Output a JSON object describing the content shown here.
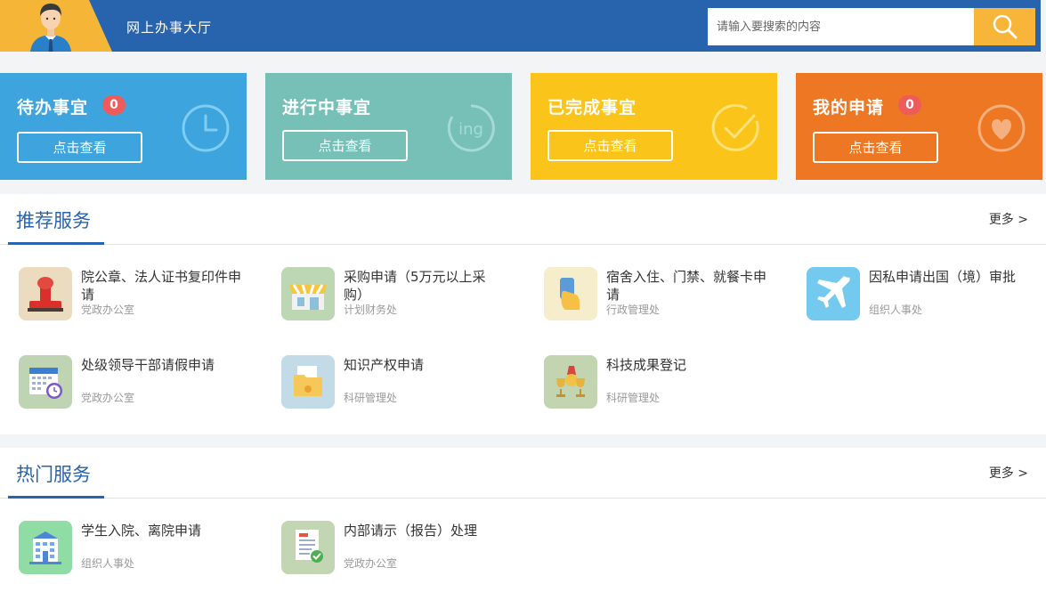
{
  "header": {
    "title": "网上办事大厅",
    "search_placeholder": "请输入要搜索的内容",
    "avatar_icon": "user-avatar-icon",
    "search_icon": "search-icon"
  },
  "cards": [
    {
      "title": "待办事宜",
      "badge": "0",
      "button": "点击查看",
      "color": "#3da4dd",
      "icon": "clock-icon"
    },
    {
      "title": "进行中事宜",
      "button": "点击查看",
      "color": "#76c0b7",
      "icon": "ing-icon",
      "icon_text": "ing"
    },
    {
      "title": "已完成事宜",
      "button": "点击查看",
      "color": "#fbc41b",
      "icon": "check-icon"
    },
    {
      "title": "我的申请",
      "badge": "0",
      "button": "点击查看",
      "color": "#ed7722",
      "icon": "heart-icon"
    }
  ],
  "recommended": {
    "title": "推荐服务",
    "more": "更多 >",
    "items": [
      {
        "name": "院公章、法人证书复印件申请",
        "dept": "党政办公室",
        "icon": "stamp-icon",
        "bg": "#ebdcc0"
      },
      {
        "name": "采购申请（5万元以上采购）",
        "dept": "计划财务处",
        "icon": "shop-icon",
        "bg": "#bdd6b3"
      },
      {
        "name": "宿舍入住、门禁、就餐卡申请",
        "dept": "行政管理处",
        "icon": "card-icon",
        "bg": "#f6edcd"
      },
      {
        "name": "因私申请出国（境）审批",
        "dept": "组织人事处",
        "icon": "airplane-icon",
        "bg": "#74c9ee"
      },
      {
        "name": "处级领导干部请假申请",
        "dept": "党政办公室",
        "icon": "calendar-icon",
        "bg": "#bfd4b3"
      },
      {
        "name": "知识产权申请",
        "dept": "科研管理处",
        "icon": "folder-icon",
        "bg": "#c3dbe6"
      },
      {
        "name": "科技成果登记",
        "dept": "科研管理处",
        "icon": "trophy-icon",
        "bg": "#c2d4b0"
      }
    ]
  },
  "hot": {
    "title": "热门服务",
    "more": "更多 >",
    "items": [
      {
        "name": "学生入院、离院申请",
        "dept": "组织人事处",
        "icon": "building-icon",
        "bg": "#8fdca5"
      },
      {
        "name": "内部请示（报告）处理",
        "dept": "党政办公室",
        "icon": "document-check-icon",
        "bg": "#c2d6b4"
      }
    ]
  }
}
